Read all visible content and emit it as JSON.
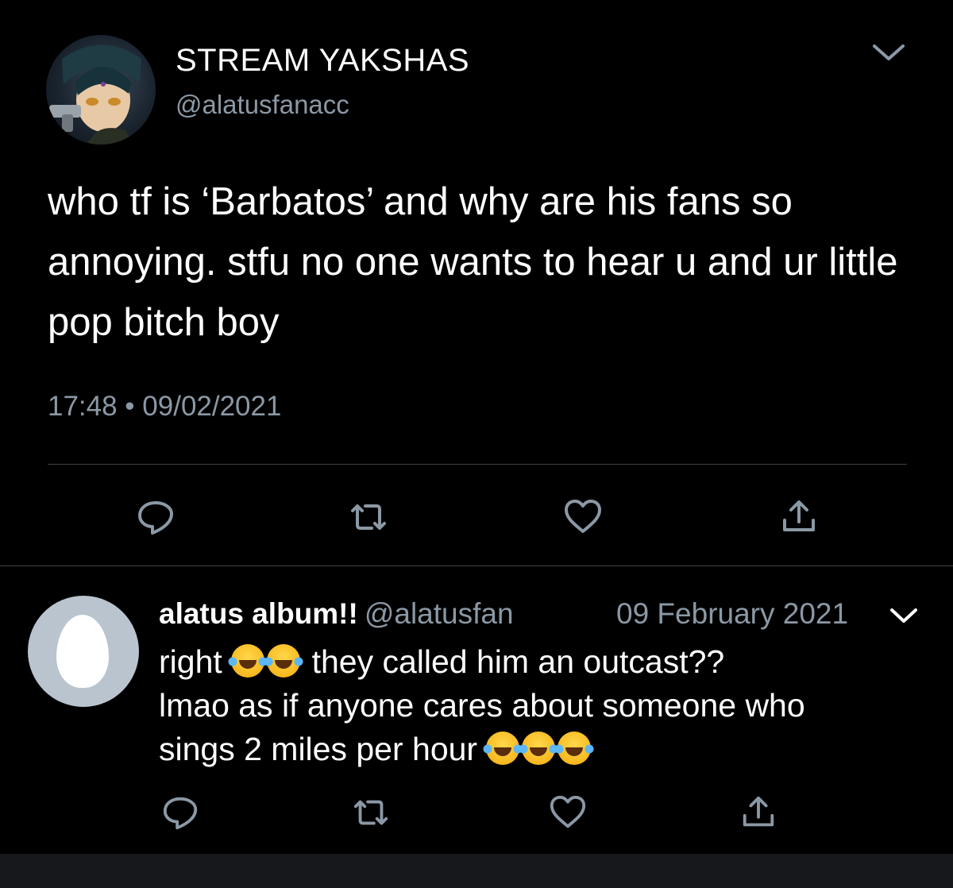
{
  "tweet": {
    "display_name": "STREAM YAKSHAS",
    "handle": "@alatusfanacc",
    "text": "who tf is ‘Barbatos’ and why are his fans so annoying. stfu no one wants to hear u and ur little pop bitch boy",
    "meta": "17:48 • 09/02/2021",
    "avatar_icon": "anime-character-avatar",
    "actions": [
      "reply-icon",
      "retweet-icon",
      "like-icon",
      "share-icon"
    ]
  },
  "reply": {
    "display_name": "alatus album!!",
    "handle": "@alatusfan",
    "date": "09 February 2021",
    "text_line1_a": "right",
    "text_line1_b": "they called him an outcast??",
    "text_line2": "lmao as if anyone cares about someone who",
    "text_line3": "sings 2 miles per hour",
    "emoji_name": "face-with-tears-of-joy",
    "avatar_icon": "default-egg-avatar",
    "actions": [
      "reply-icon",
      "retweet-icon",
      "like-icon",
      "share-icon"
    ]
  },
  "colors": {
    "background": "#000000",
    "text": "#ffffff",
    "secondary_text": "#8b98a5",
    "divider": "#3d4248"
  }
}
